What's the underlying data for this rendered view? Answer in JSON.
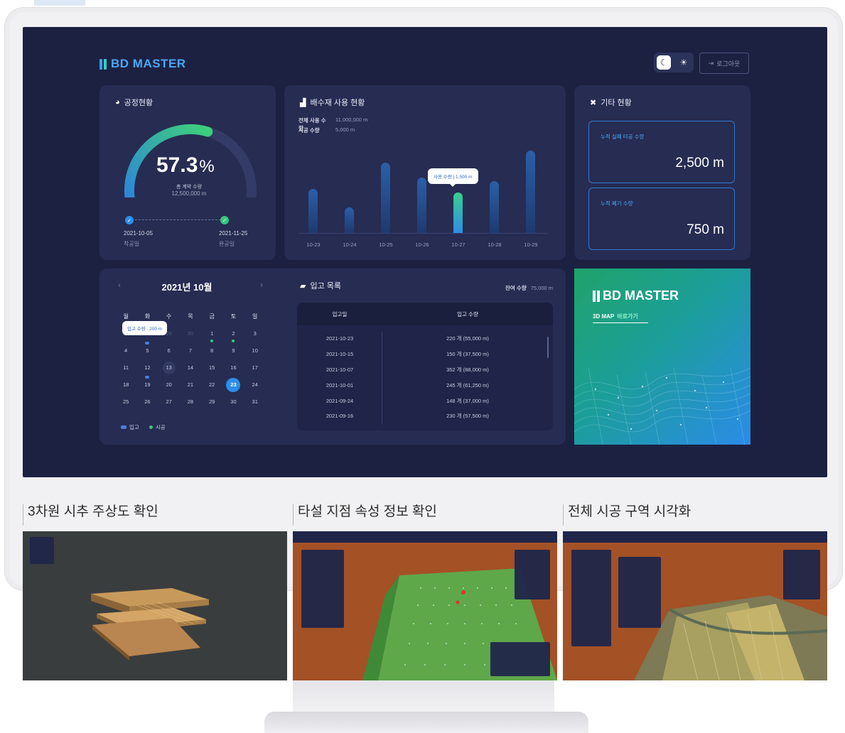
{
  "app": {
    "brand": "BD MASTER"
  },
  "header": {
    "logout_label": "로그아웃",
    "theme_dark_icon": "moon-icon",
    "theme_light_icon": "sun-icon"
  },
  "process": {
    "title": "공정현황",
    "percent_value": "57.3",
    "percent_sign": "%",
    "percent": 57.3,
    "contract_label": "총 계약 수량",
    "contract_value": "12,500,000 m",
    "start_date": "2021-10-05",
    "start_label": "착공일",
    "end_date": "2021-11-25",
    "end_label": "완공일"
  },
  "usage": {
    "title": "배수재 사용 현황",
    "total_label": "전체 사용 수량",
    "total_value": "11,000,000 m",
    "construct_label": "시공 수량",
    "construct_value": "5,000 m",
    "tooltip": "사용 수량 | 1,500 m"
  },
  "chart_data": {
    "type": "bar",
    "categories": [
      "10-23",
      "10-24",
      "10-25",
      "10-26",
      "10-27",
      "10-28",
      "10-29"
    ],
    "values": [
      0.44,
      0.26,
      0.71,
      0.56,
      0.41,
      0.52,
      0.83
    ],
    "highlight_index": 4,
    "title": "배수재 사용 현황"
  },
  "other": {
    "title": "기타 현황",
    "box1_label": "누적 실패 타공 수량",
    "box1_value": "2,500 m",
    "box2_label": "누적 폐기 수량",
    "box2_value": "750 m"
  },
  "calendar": {
    "title": "2021년 10월",
    "weekdays": [
      "월",
      "화",
      "수",
      "목",
      "금",
      "토",
      "일"
    ],
    "tooltip": "입고 수량 : 200 m",
    "legend_in": "입고",
    "legend_construct": "시공",
    "weeks": [
      [
        "27",
        "28",
        "29",
        "30",
        "1",
        "2",
        "3"
      ],
      [
        "4",
        "5",
        "6",
        "7",
        "8",
        "9",
        "10"
      ],
      [
        "11",
        "12",
        "13",
        "14",
        "15",
        "16",
        "17"
      ],
      [
        "18",
        "19",
        "20",
        "21",
        "22",
        "23",
        "24"
      ],
      [
        "25",
        "26",
        "27",
        "28",
        "29",
        "30",
        "31"
      ]
    ]
  },
  "incoming": {
    "title": "입고 목록",
    "remaining_label": "잔여 수량",
    "remaining_value": "75,000 m",
    "col_date": "입고일",
    "col_qty": "입고 수량",
    "rows": [
      {
        "date": "2021-10-23",
        "qty": "220 개 (55,000 m)"
      },
      {
        "date": "2021-10-15",
        "qty": "150 개 (37,500 m)"
      },
      {
        "date": "2021-10-07",
        "qty": "352 개 (88,000 m)"
      },
      {
        "date": "2021-10-01",
        "qty": "245 개 (61,250 m)"
      },
      {
        "date": "2021-09-24",
        "qty": "148 개 (37,000 m)"
      },
      {
        "date": "2021-09-16",
        "qty": "230 개 (57,500 m)"
      }
    ]
  },
  "promo": {
    "brand": "BD MASTER",
    "link_prefix": "3D MAP",
    "link_suffix": "바로가기"
  },
  "previews": [
    {
      "title": "3차원 시추 주상도 확인"
    },
    {
      "title": "타설 지점 속성 정보 확인"
    },
    {
      "title": "전체 시공 구역 시각화"
    }
  ]
}
